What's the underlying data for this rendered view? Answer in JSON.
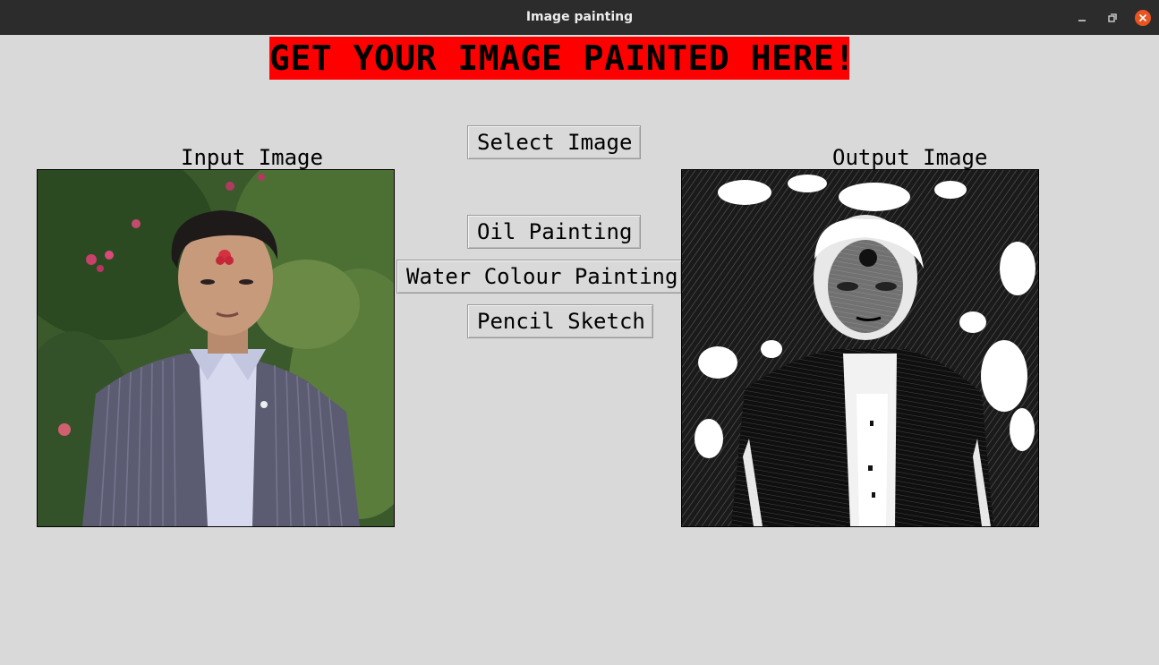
{
  "window": {
    "title": "Image painting",
    "controls": [
      "minimize-icon",
      "restore-icon",
      "close-icon"
    ],
    "close_color": "#e95420"
  },
  "banner": {
    "text": "GET YOUR IMAGE PAINTED HERE!",
    "background": "#ff0000"
  },
  "labels": {
    "input": "Input Image",
    "output": "Output Image"
  },
  "buttons": {
    "select": "Select Image",
    "oil": "Oil Painting",
    "water": "Water Colour Painting",
    "pencil": "Pencil Sketch"
  },
  "images": {
    "input": "portrait-photo",
    "output": "pencil-sketch-result"
  }
}
